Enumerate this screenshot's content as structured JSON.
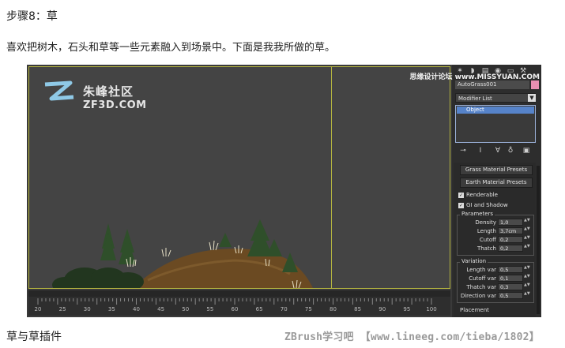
{
  "article": {
    "step_title": "步骤8：草",
    "intro": "喜欢把树木，石头和草等一些元素融入到场景中。下面是我我所做的草。",
    "caption": "草与草插件",
    "bottom_watermark": "ZBrush学习吧 【www.lineeg.com/tieba/1802】"
  },
  "viewport_logo": {
    "cn": "朱峰社区",
    "en": "ZF3D.COM"
  },
  "panel": {
    "watermark": "思缘设计论坛 www.MISSYUAN.COM",
    "object_name": "AutoGrass001",
    "object_color": "#e88fb2",
    "modifier_list_label": "Modifier List",
    "stack_item": "Object",
    "rollout": {
      "grass_presets_label": "Grass Material Presets",
      "earth_presets_label": "Earth Material Presets",
      "renderable_label": "Renderable",
      "gi_shadow_label": "GI and Shadow",
      "parameters_label": "Parameters",
      "parameters": [
        {
          "label": "Density",
          "value": "1,0"
        },
        {
          "label": "Length",
          "value": "3,7cm"
        },
        {
          "label": "Cutoff",
          "value": "0,2"
        },
        {
          "label": "Thatch",
          "value": "0,2"
        }
      ],
      "variation_label": "Variation",
      "variation": [
        {
          "label": "Length var",
          "value": "0,5"
        },
        {
          "label": "Cutoff var",
          "value": "0,1"
        },
        {
          "label": "Thatch var",
          "value": "0,3"
        },
        {
          "label": "Direction var",
          "value": "0,5"
        }
      ],
      "placement_label": "Placement"
    }
  },
  "timeline": {
    "ticks": [
      "20",
      "25",
      "30",
      "35",
      "40",
      "45",
      "50",
      "55",
      "60",
      "65",
      "70",
      "75",
      "80",
      "85",
      "90",
      "95",
      "100"
    ]
  },
  "colors": {
    "viewport_bg": "#444444",
    "viewport_border": "#b5b540",
    "selection_blue": "#5683c9"
  },
  "icons": {
    "toolbar": [
      "pin-icon",
      "modifier-stack-icon",
      "modifier-toggle-icon",
      "remove-modifier-icon",
      "configure-icon"
    ]
  }
}
